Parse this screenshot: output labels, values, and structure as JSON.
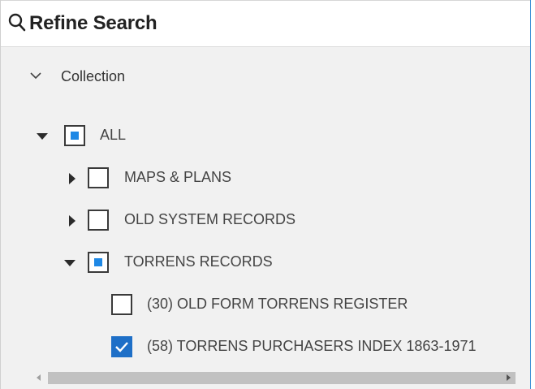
{
  "header": {
    "title": "Refine Search",
    "icon": "search-icon"
  },
  "filter": {
    "section_label": "Collection",
    "tree": [
      {
        "label": "ALL",
        "state": "partial",
        "expanded": true
      },
      {
        "label": "MAPS & PLANS",
        "state": "unchecked",
        "expanded": false
      },
      {
        "label": "OLD SYSTEM RECORDS",
        "state": "unchecked",
        "expanded": false
      },
      {
        "label": "TORRENS RECORDS",
        "state": "partial",
        "expanded": true
      },
      {
        "label": "(30) OLD FORM TORRENS REGISTER",
        "state": "unchecked"
      },
      {
        "label": "(58) TORRENS PURCHASERS INDEX 1863-1971",
        "state": "checked"
      }
    ]
  },
  "colors": {
    "accent": "#1e88e5",
    "checked": "#1e6fc7",
    "panel_border": "#3a8fd6"
  }
}
